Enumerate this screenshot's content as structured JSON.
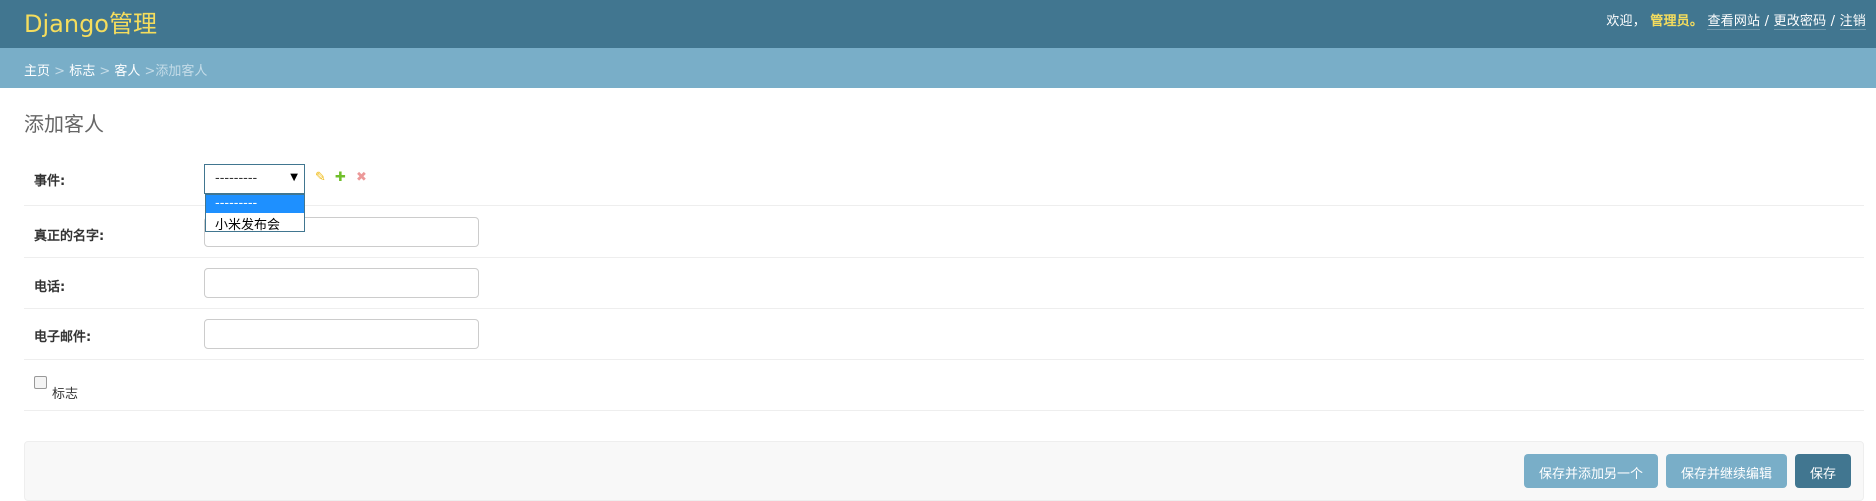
{
  "header": {
    "site_name": "Django管理",
    "welcome": "欢迎，",
    "username": "管理员。",
    "view_site": "查看网站",
    "separator": " / ",
    "change_password": "更改密码",
    "logout": "注销"
  },
  "breadcrumbs": {
    "home": "主页",
    "app": "标志",
    "model": "客人",
    "current": "添加客人",
    "sep": " > "
  },
  "page_title": "添加客人",
  "form": {
    "event": {
      "label": "事件:",
      "selected": "---------",
      "options": [
        "---------",
        "小米发布会"
      ],
      "change_icon": "pencil-icon",
      "add_icon": "plus-icon",
      "delete_icon": "x-icon"
    },
    "realname": {
      "label": "真正的名字:",
      "value": ""
    },
    "phone": {
      "label": "电话:",
      "value": ""
    },
    "email": {
      "label": "电子邮件:",
      "value": ""
    },
    "sign": {
      "label": "标志",
      "checked": false
    }
  },
  "submit": {
    "save_add_another": "保存并添加另一个",
    "save_continue": "保存并继续编辑",
    "save": "保存"
  },
  "colors": {
    "header_bg": "#417690",
    "breadcrumb_bg": "#79aec8",
    "site_name": "#f5dd5d",
    "highlight": "#1e90ff"
  }
}
